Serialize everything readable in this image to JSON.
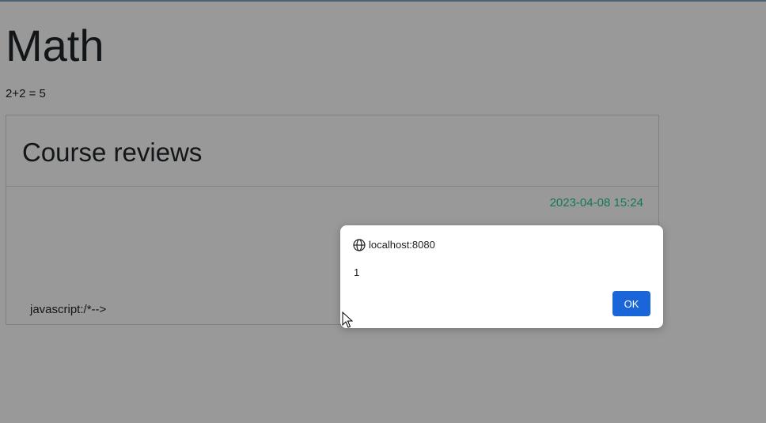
{
  "page": {
    "title": "Math",
    "course_text": "2+2 = 5"
  },
  "reviews": {
    "title": "Course reviews",
    "items": [
      {
        "date": "2023-04-08 15:24",
        "body": "javascript:/*-->"
      }
    ]
  },
  "alert": {
    "origin": "localhost:8080",
    "message": "1",
    "ok_label": "OK",
    "icon": "globe-icon"
  },
  "colors": {
    "date": "#20c997",
    "ok_button": "#1a66d8",
    "overlay": "rgba(0,0,0,0.40)"
  }
}
